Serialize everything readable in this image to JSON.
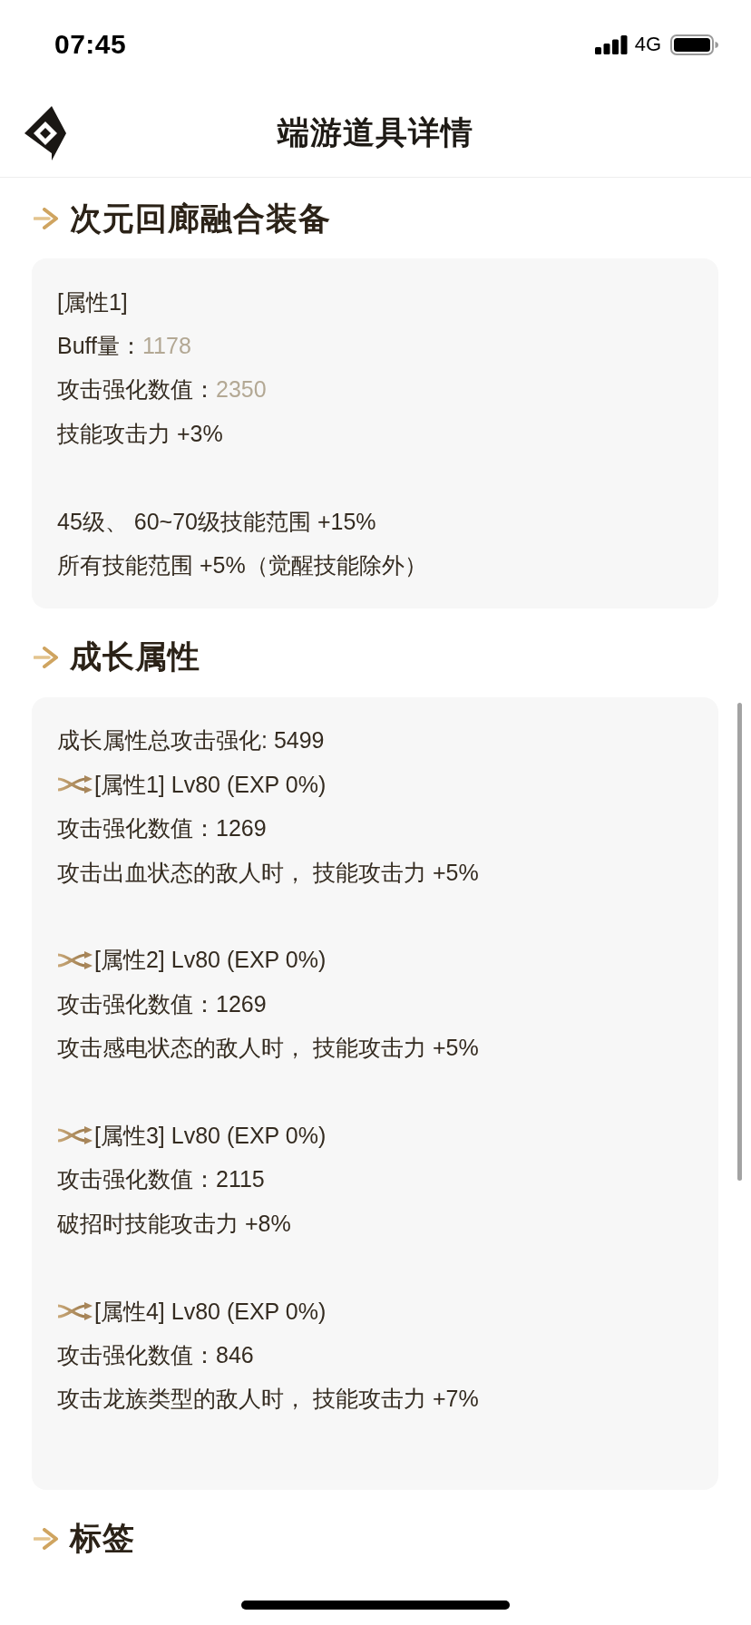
{
  "status_bar": {
    "time": "07:45",
    "network": "4G"
  },
  "header": {
    "title": "端游道具详情"
  },
  "sections": [
    {
      "title": "次元回廊融合装备",
      "paragraphs": [
        {
          "lines": [
            {
              "kind": "plain",
              "text": "[属性1]"
            },
            {
              "kind": "stat",
              "label": "Buff量：",
              "value": "1178"
            },
            {
              "kind": "stat",
              "label": "攻击强化数值：",
              "value": "2350"
            },
            {
              "kind": "plain",
              "text": "技能攻击力 +3%"
            }
          ]
        },
        {
          "lines": [
            {
              "kind": "plain",
              "text": "45级、 60~70级技能范围 +15%"
            },
            {
              "kind": "plain",
              "text": "所有技能范围 +5%（觉醒技能除外）"
            }
          ]
        }
      ]
    },
    {
      "title": "成长属性",
      "paragraphs": [
        {
          "lines": [
            {
              "kind": "plain",
              "text": "成长属性总攻击强化: 5499"
            },
            {
              "kind": "growth",
              "text": "[属性1] Lv80 (EXP 0%)"
            },
            {
              "kind": "plain",
              "text": "攻击强化数值：1269"
            },
            {
              "kind": "plain",
              "text": "攻击出血状态的敌人时， 技能攻击力 +5%"
            }
          ]
        },
        {
          "lines": [
            {
              "kind": "growth",
              "text": "[属性2] Lv80 (EXP 0%)"
            },
            {
              "kind": "plain",
              "text": "攻击强化数值：1269"
            },
            {
              "kind": "plain",
              "text": "攻击感电状态的敌人时， 技能攻击力 +5%"
            }
          ]
        },
        {
          "lines": [
            {
              "kind": "growth",
              "text": "[属性3] Lv80 (EXP 0%)"
            },
            {
              "kind": "plain",
              "text": "攻击强化数值：2115"
            },
            {
              "kind": "plain",
              "text": "破招时技能攻击力 +8%"
            }
          ]
        },
        {
          "lines": [
            {
              "kind": "growth",
              "text": "[属性4] Lv80 (EXP 0%)"
            },
            {
              "kind": "plain",
              "text": "攻击强化数值：846"
            },
            {
              "kind": "plain",
              "text": "攻击龙族类型的敌人时， 技能攻击力 +7%"
            }
          ]
        }
      ]
    },
    {
      "title": "标签"
    }
  ]
}
